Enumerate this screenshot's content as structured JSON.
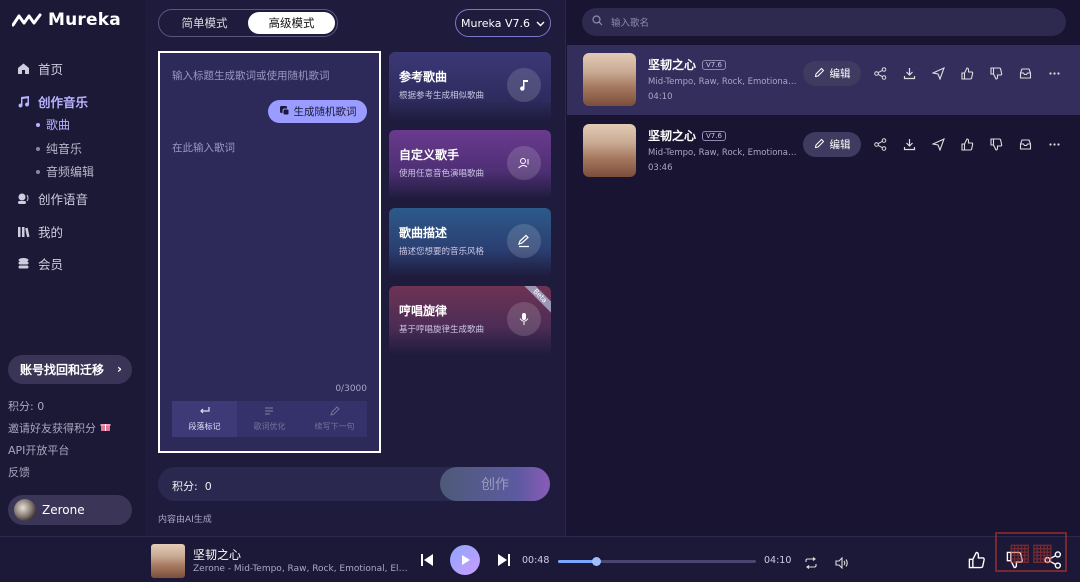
{
  "app": {
    "name": "Mureka"
  },
  "sidebar": {
    "nav": [
      {
        "label": "首页",
        "icon": "home-icon"
      },
      {
        "label": "创作音乐",
        "icon": "music-note-icon",
        "active": true
      },
      {
        "label": "创作语音",
        "icon": "voice-icon"
      },
      {
        "label": "我的",
        "icon": "library-icon"
      },
      {
        "label": "会员",
        "icon": "coins-icon"
      }
    ],
    "sub": [
      {
        "label": "歌曲",
        "active": true
      },
      {
        "label": "纯音乐"
      },
      {
        "label": "音频编辑"
      }
    ],
    "recover_label": "账号找回和迁移",
    "credits_text": "积分: 0",
    "invite_text": "邀请好友获得积分",
    "api_text": "API开放平台",
    "feedback_text": "反馈",
    "user_name": "Zerone"
  },
  "main": {
    "modes": [
      "简单模式",
      "高级模式"
    ],
    "selected_mode": "高级模式",
    "version": "Mureka V7.6",
    "title_placeholder": "输入标题生成歌词或使用随机歌词",
    "random_button": "生成随机歌词",
    "lyrics_placeholder": "在此输入歌词",
    "counter": "0/3000",
    "tools": [
      "段落标记",
      "歌词优化",
      "续写下一句"
    ],
    "cards": [
      {
        "title": "参考歌曲",
        "subtitle": "根据参考生成相似歌曲",
        "icon": "music-note-icon"
      },
      {
        "title": "自定义歌手",
        "subtitle": "使用任意音色演唱歌曲",
        "icon": "singer-icon"
      },
      {
        "title": "歌曲描述",
        "subtitle": "描述您想要的音乐风格",
        "icon": "pen-icon"
      },
      {
        "title": "哼唱旋律",
        "subtitle": "基于哼唱旋律生成歌曲",
        "icon": "microphone-icon",
        "badge": "Beta"
      }
    ],
    "credits_label": "积分:",
    "credits_value": "0",
    "create_button": "创作",
    "ai_note": "内容由AI生成"
  },
  "right": {
    "search_placeholder": "输入歌名",
    "songs": [
      {
        "title": "坚韧之心",
        "version": "V7.6",
        "desc": "Mid-Tempo, Raw, Rock, Emotional, Electric…",
        "duration": "04:10",
        "edit": "编辑"
      },
      {
        "title": "坚韧之心",
        "version": "V7.6",
        "desc": "Mid-Tempo, Raw, Rock, Emotional, Electric…",
        "duration": "03:46",
        "edit": "编辑"
      }
    ]
  },
  "player": {
    "title": "坚韧之心",
    "subtitle": "Zerone - Mid-Tempo, Raw, Rock, Emotional, Electric...",
    "current": "00:48",
    "total": "04:10",
    "progress": 0.19
  },
  "colors": {
    "accent": "#b9b2ff",
    "background": "#1a1733"
  }
}
